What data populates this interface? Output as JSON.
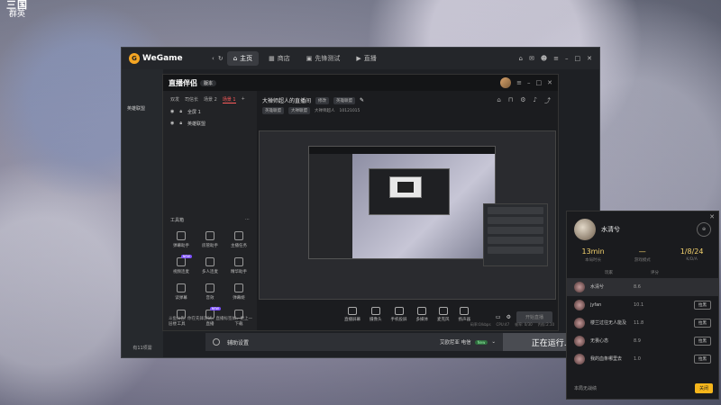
{
  "desktop": {
    "logo_top": "三国",
    "logo_sub": "群英"
  },
  "wegame": {
    "brand": "WeGame",
    "tabs": [
      {
        "label": "主页",
        "icon": "home-icon",
        "active": true
      },
      {
        "label": "商店",
        "icon": "store-icon",
        "active": false
      },
      {
        "label": "先锋测试",
        "icon": "test-icon",
        "active": false
      },
      {
        "label": "直播",
        "icon": "live-icon",
        "active": false
      }
    ],
    "sidebar_item": "英雄联盟",
    "left_status": "有11项需",
    "aux_label": "辅助设置",
    "hero_label": "艾欧尼亚 电信",
    "hero_badge": "New",
    "start_label": "正在运行..."
  },
  "stream": {
    "app_name": "直播伴侣",
    "version": "版本",
    "scene_tabs": [
      "双发",
      "司信长",
      "场景 2",
      "场景 1"
    ],
    "layers": [
      "全屏 1",
      "英雄联盟"
    ],
    "tools_title": "工具箱",
    "tools": [
      {
        "label": "弹幕助手",
        "tag": ""
      },
      {
        "label": "房管助手",
        "tag": ""
      },
      {
        "label": "主播任务",
        "tag": ""
      },
      {
        "label": "视频连麦",
        "tag": "NEW"
      },
      {
        "label": "多人连麦",
        "tag": ""
      },
      {
        "label": "精华助手",
        "tag": ""
      },
      {
        "label": "读弹幕",
        "tag": ""
      },
      {
        "label": "音效",
        "tag": ""
      },
      {
        "label": "弹幕姬",
        "tag": ""
      },
      {
        "label": "工具",
        "tag": ""
      },
      {
        "label": "直播",
        "tag": "NEW"
      },
      {
        "label": "下载",
        "tag": ""
      }
    ],
    "notice": "斗鱼公告: 你在先锋测试，直播标签如，更上一层楼",
    "room_title": "大禅师超人的直播间",
    "room_chip1": "修改",
    "room_chip2": "英雄联盟",
    "room_sub1": "英雄联盟",
    "room_sub2": "大禅联盟",
    "room_sub3": "大禅师超人",
    "room_sub4": "10121015",
    "controls": [
      "直播屏幕",
      "摄像头",
      "手机投屏",
      "多媒体",
      "麦克风",
      "扬声器"
    ],
    "go_live": "开始直播",
    "stats": [
      "码率:0/kbps",
      "CPU:47",
      "帧率: 0/30",
      "内存:2.10"
    ]
  },
  "game_panel": {
    "player": "水清兮",
    "stats": [
      {
        "value": "13min",
        "label": "本局时长"
      },
      {
        "value": "—",
        "label": "游戏模式"
      },
      {
        "value": "1/8/24",
        "label": "K/D/A"
      }
    ],
    "cols": [
      "玩家",
      "评分"
    ],
    "rows": [
      {
        "name": "水清兮",
        "score": "8.6",
        "me": true,
        "action": ""
      },
      {
        "name": "jyfan",
        "score": "10.1",
        "me": false,
        "action": "拉黑"
      },
      {
        "name": "楼兰过往无人能及",
        "score": "11.8",
        "me": false,
        "action": "拉黑"
      },
      {
        "name": "无畏心态",
        "score": "8.9",
        "me": false,
        "action": "拉黑"
      },
      {
        "name": "我的血条哪里去",
        "score": "1.0",
        "me": false,
        "action": "拉黑"
      }
    ],
    "footer": "本局无战绩",
    "close": "关闭"
  }
}
